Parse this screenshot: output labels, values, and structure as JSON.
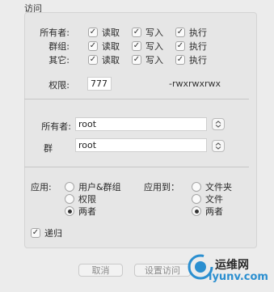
{
  "section_title": "访问",
  "permissions": {
    "rows": [
      {
        "label": "所有者:",
        "read": true,
        "write": true,
        "execute": true
      },
      {
        "label": "群组:",
        "read": true,
        "write": true,
        "execute": true
      },
      {
        "label": "其它:",
        "read": true,
        "write": true,
        "execute": true
      }
    ],
    "read_label": "读取",
    "write_label": "写入",
    "execute_label": "执行"
  },
  "mode": {
    "label": "权限:",
    "value": "777",
    "symbolic": "-rwxrwxrwx"
  },
  "ownership": {
    "owner_label": "所有者:",
    "owner_value": "root",
    "group_label": "群",
    "group_value": "root"
  },
  "apply": {
    "label": "应用:",
    "options": [
      "用户&群组",
      "权限",
      "两者"
    ],
    "selected": "两者",
    "target_label": "应用到：",
    "target_options": [
      "文件夹",
      "文件",
      "两者"
    ],
    "target_selected": "两者"
  },
  "recursive": {
    "label": "递归",
    "checked": true
  },
  "buttons": {
    "cancel": "取消",
    "set_access": "设置访问"
  },
  "watermark": {
    "text_cn": "运维网",
    "text_en": "iyunv.com"
  }
}
